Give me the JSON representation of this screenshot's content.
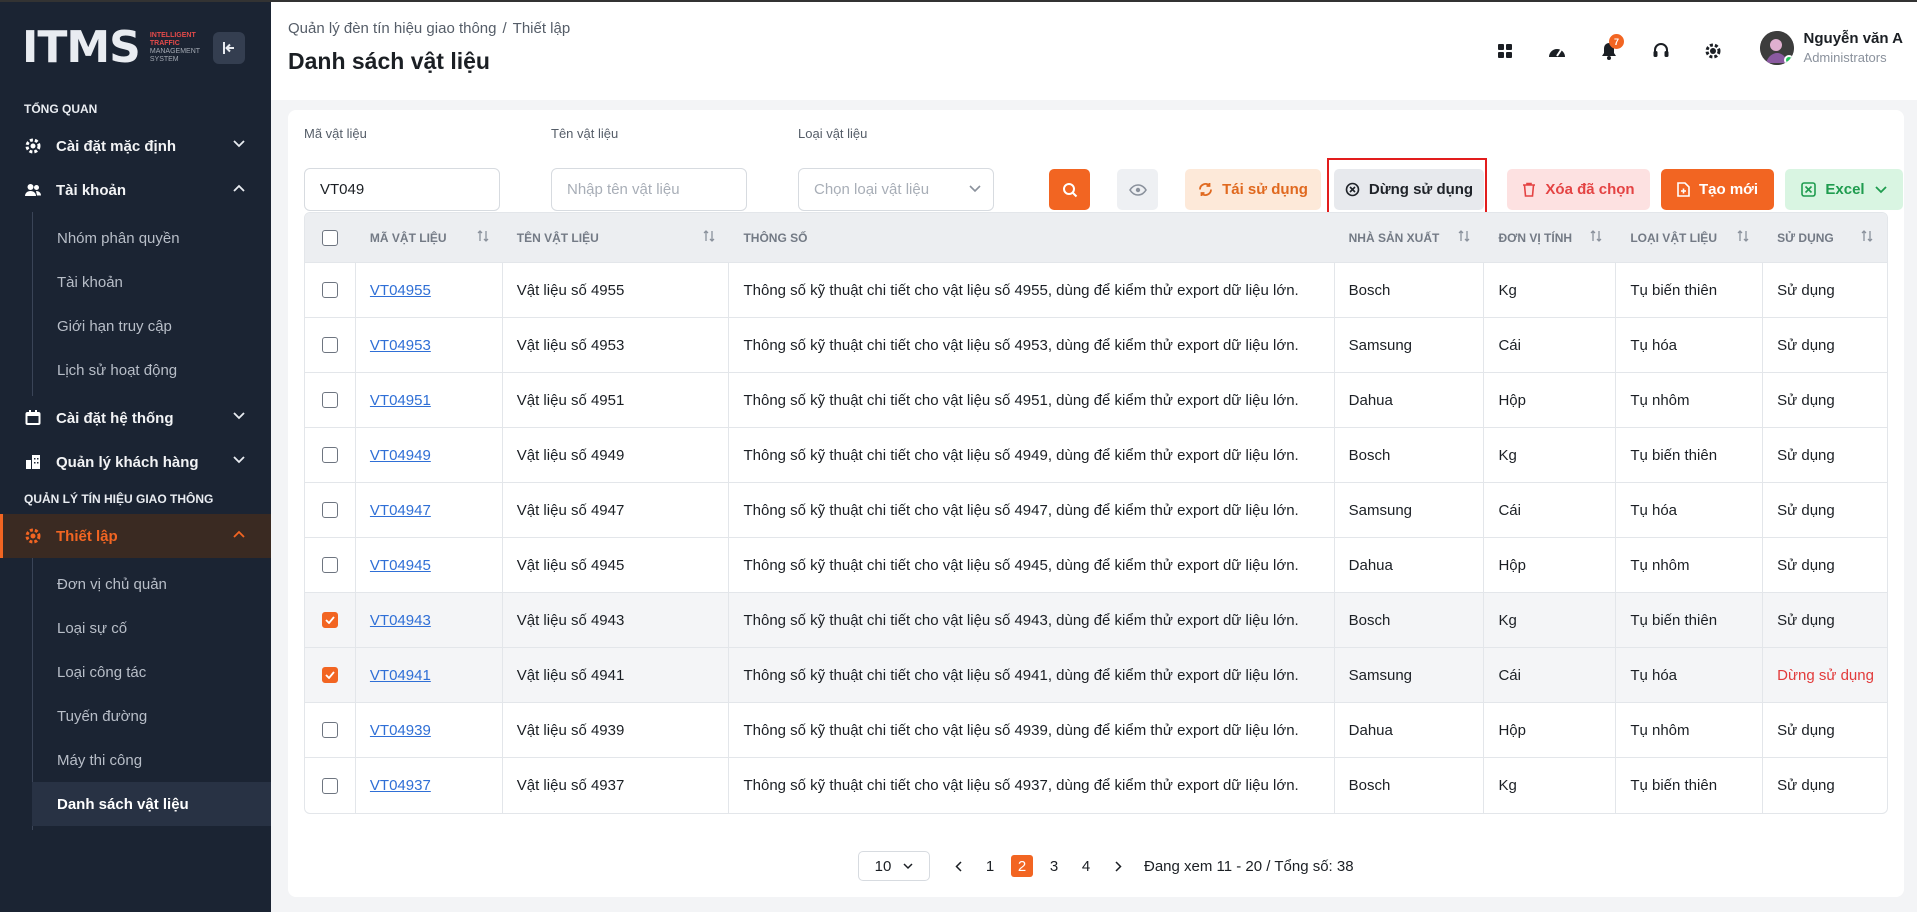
{
  "logo": {
    "mark": "ITMS",
    "sub1": "INTELLIGENT",
    "sub2": "TRAFFIC",
    "sub3": "MANAGEMENT",
    "sub4": "SYSTEM"
  },
  "sidebar": {
    "section1": "TỔNG QUAN",
    "group_default": "Cài đặt mặc định",
    "group_account": "Tài khoản",
    "account_items": [
      "Nhóm phân quyền",
      "Tài khoản",
      "Giới hạn truy cập",
      "Lịch sử hoạt động"
    ],
    "group_system": "Cài đặt hệ thống",
    "group_customer": "Quản lý khách hàng",
    "section2": "QUẢN LÝ TÍN HIỆU GIAO THÔNG",
    "group_setup": "Thiết lập",
    "setup_items": [
      "Đơn vị chủ quản",
      "Loại sự cố",
      "Loại công tác",
      "Tuyến đường",
      "Máy thi công",
      "Danh sách vật liệu"
    ]
  },
  "header": {
    "breadcrumb_1": "Quản lý đèn tín hiệu giao thông",
    "breadcrumb_sep": "/",
    "breadcrumb_2": "Thiết lập",
    "title": "Danh sách vật liệu",
    "notif_count": "7",
    "user_name": "Nguyễn văn A",
    "user_role": "Administrators"
  },
  "filters": {
    "code_label": "Mã vật liệu",
    "code_value": "VT049",
    "name_label": "Tên vật liệu",
    "name_placeholder": "Nhập tên vật liệu",
    "type_label": "Loại vật liệu",
    "type_placeholder": "Chọn loại vật liệu"
  },
  "actions": {
    "reuse": "Tái sử dụng",
    "stop": "Dừng sử dụng",
    "delete": "Xóa đã chọn",
    "create": "Tạo mới",
    "excel": "Excel"
  },
  "table": {
    "headers": [
      "MÃ VẬT LIỆU",
      "TÊN VẬT LIỆU",
      "THÔNG SỐ",
      "NHÀ SẢN XUẤT",
      "ĐƠN VỊ TÍNH",
      "LOẠI VẬT LIỆU",
      "SỬ DỤNG"
    ],
    "rows": [
      {
        "code": "VT04955",
        "name": "Vật liệu số 4955",
        "spec": "Thông số kỹ thuật chi tiết cho vật liệu số 4955, dùng để kiểm thử export dữ liệu lớn.",
        "maker": "Bosch",
        "unit": "Kg",
        "type": "Tụ biến thiên",
        "status": "Sử dụng",
        "checked": false
      },
      {
        "code": "VT04953",
        "name": "Vật liệu số 4953",
        "spec": "Thông số kỹ thuật chi tiết cho vật liệu số 4953, dùng để kiểm thử export dữ liệu lớn.",
        "maker": "Samsung",
        "unit": "Cái",
        "type": "Tụ hóa",
        "status": "Sử dụng",
        "checked": false
      },
      {
        "code": "VT04951",
        "name": "Vật liệu số 4951",
        "spec": "Thông số kỹ thuật chi tiết cho vật liệu số 4951, dùng để kiểm thử export dữ liệu lớn.",
        "maker": "Dahua",
        "unit": "Hộp",
        "type": "Tụ nhôm",
        "status": "Sử dụng",
        "checked": false
      },
      {
        "code": "VT04949",
        "name": "Vật liệu số 4949",
        "spec": "Thông số kỹ thuật chi tiết cho vật liệu số 4949, dùng để kiểm thử export dữ liệu lớn.",
        "maker": "Bosch",
        "unit": "Kg",
        "type": "Tụ biến thiên",
        "status": "Sử dụng",
        "checked": false
      },
      {
        "code": "VT04947",
        "name": "Vật liệu số 4947",
        "spec": "Thông số kỹ thuật chi tiết cho vật liệu số 4947, dùng để kiểm thử export dữ liệu lớn.",
        "maker": "Samsung",
        "unit": "Cái",
        "type": "Tụ hóa",
        "status": "Sử dụng",
        "checked": false
      },
      {
        "code": "VT04945",
        "name": "Vật liệu số 4945",
        "spec": "Thông số kỹ thuật chi tiết cho vật liệu số 4945, dùng để kiểm thử export dữ liệu lớn.",
        "maker": "Dahua",
        "unit": "Hộp",
        "type": "Tụ nhôm",
        "status": "Sử dụng",
        "checked": false
      },
      {
        "code": "VT04943",
        "name": "Vật liệu số 4943",
        "spec": "Thông số kỹ thuật chi tiết cho vật liệu số 4943, dùng để kiểm thử export dữ liệu lớn.",
        "maker": "Bosch",
        "unit": "Kg",
        "type": "Tụ biến thiên",
        "status": "Sử dụng",
        "checked": true
      },
      {
        "code": "VT04941",
        "name": "Vật liệu số 4941",
        "spec": "Thông số kỹ thuật chi tiết cho vật liệu số 4941, dùng để kiểm thử export dữ liệu lớn.",
        "maker": "Samsung",
        "unit": "Cái",
        "type": "Tụ hóa",
        "status": "Dừng sử dụng",
        "checked": true
      },
      {
        "code": "VT04939",
        "name": "Vật liệu số 4939",
        "spec": "Thông số kỹ thuật chi tiết cho vật liệu số 4939, dùng để kiểm thử export dữ liệu lớn.",
        "maker": "Dahua",
        "unit": "Hộp",
        "type": "Tụ nhôm",
        "status": "Sử dụng",
        "checked": false
      },
      {
        "code": "VT04937",
        "name": "Vật liệu số 4937",
        "spec": "Thông số kỹ thuật chi tiết cho vật liệu số 4937, dùng để kiểm thử export dữ liệu lớn.",
        "maker": "Bosch",
        "unit": "Kg",
        "type": "Tụ biến thiên",
        "status": "Sử dụng",
        "checked": false
      }
    ]
  },
  "pagination": {
    "page_size": "10",
    "pages": [
      "1",
      "2",
      "3",
      "4"
    ],
    "current_page": "2",
    "info": "Đang xem 11 - 20 / Tổng số: 38"
  },
  "colors": {
    "accent": "#f26522",
    "sidebar_bg": "#1b2433",
    "link": "#2f6fd6",
    "danger": "#e23b3b",
    "success": "#1f9c4f"
  },
  "icons": [
    "collapse-sidebar-icon",
    "gear-icon",
    "users-icon",
    "chevron-down-icon",
    "chevron-up-icon",
    "calendar-icon",
    "building-icon",
    "apps-grid-icon",
    "dashboard-gauge-icon",
    "bell-icon",
    "headset-icon",
    "settings-icon",
    "search-icon",
    "eye-icon",
    "refresh-icon",
    "stop-circle-icon",
    "trash-icon",
    "file-plus-icon",
    "excel-icon",
    "sort-icon",
    "chevron-left-icon",
    "chevron-right-icon"
  ]
}
